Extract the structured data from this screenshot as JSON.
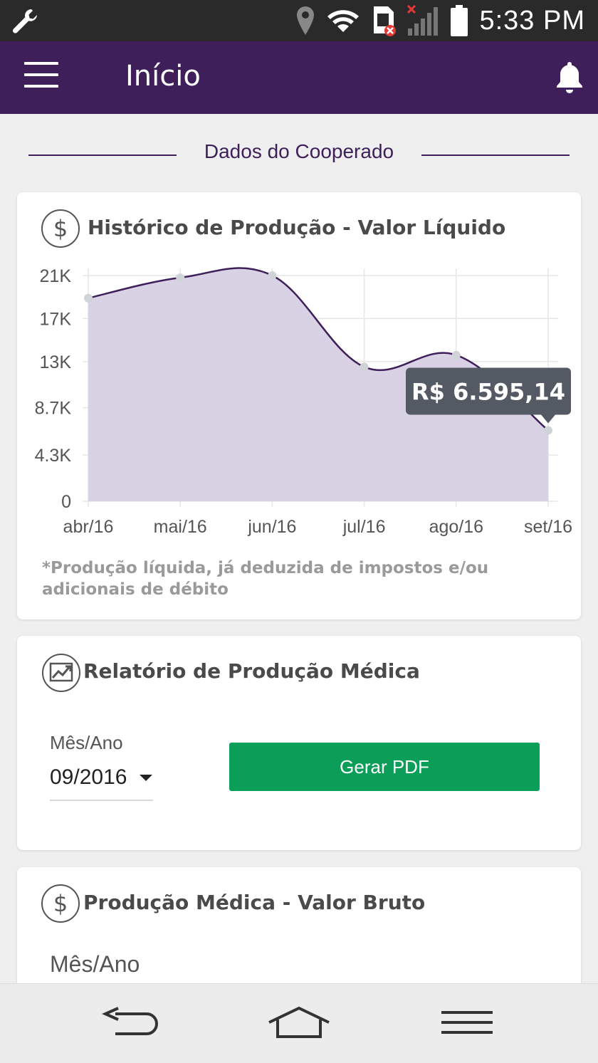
{
  "status_bar": {
    "time": "5:33 PM"
  },
  "app_bar": {
    "title": "Início"
  },
  "section": {
    "title": "Dados do Cooperado"
  },
  "production_history": {
    "title": "Histórico de Produção - Valor Líquido",
    "icon": "dollar-icon",
    "note": "*Produção líquida, já deduzida de impostos e/ou adicionais de débito",
    "tooltip": "R$ 6.595,14"
  },
  "chart_data": {
    "type": "area",
    "categories": [
      "abr/16",
      "mai/16",
      "jun/16",
      "jul/16",
      "ago/16",
      "set/16"
    ],
    "series": [
      {
        "values": [
          18900,
          20800,
          21000,
          12500,
          13600,
          6595.14
        ]
      }
    ],
    "y_ticks": [
      "0",
      "4.3K",
      "8.7K",
      "13K",
      "17K",
      "21K"
    ],
    "y_tick_values": [
      0,
      4300,
      8700,
      13000,
      17000,
      21000
    ],
    "ylim": [
      0,
      21000
    ],
    "grid": true,
    "colors": {
      "line": "#3e1f5a",
      "fill": "#d9d1e4",
      "point": "#d0d4d8",
      "tooltip": "#545a63"
    }
  },
  "report": {
    "title": "Relatório de Produção Médica",
    "icon": "trending-chart-icon",
    "month_label": "Mês/Ano",
    "month_value": "09/2016",
    "button_label": "Gerar PDF",
    "button_color": "#0b9e59"
  },
  "gross": {
    "title": "Produção Médica - Valor Bruto",
    "icon": "dollar-icon",
    "month_label": "Mês/Ano"
  },
  "colors": {
    "primary": "#3e1f5a",
    "background": "#efefef"
  }
}
